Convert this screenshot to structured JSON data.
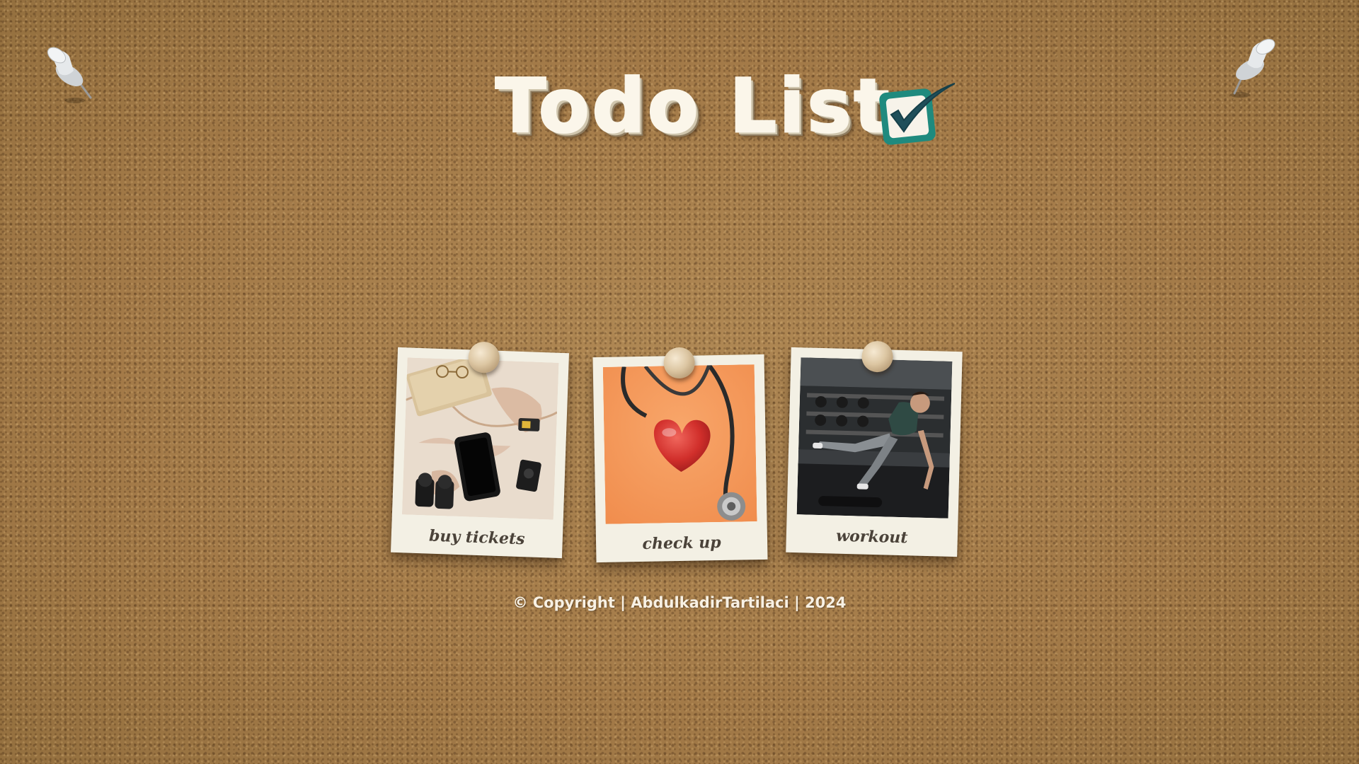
{
  "page": {
    "title": "Todo List"
  },
  "todos": [
    {
      "label": "buy tickets",
      "photo_icon": "travel-map-icon"
    },
    {
      "label": "check up",
      "photo_icon": "stethoscope-heart-icon"
    },
    {
      "label": "workout",
      "photo_icon": "gym-workout-icon"
    }
  ],
  "footer": {
    "text": "© Copyright | AbdulkadirTartilaci | 2024"
  },
  "colors": {
    "cork_background": "#a8804f",
    "title_text": "#fbf6ea",
    "check_badge": "#1f8a7e",
    "card_paper": "#f3f0e4",
    "caption_text": "#4a4239",
    "footer_text": "#f8f1e4"
  },
  "icons": {
    "corner_pins": [
      "push-pin-icon",
      "push-pin-icon"
    ],
    "title_badge": "checkbox-checked-icon",
    "card_tack": "thumbtack-icon"
  }
}
